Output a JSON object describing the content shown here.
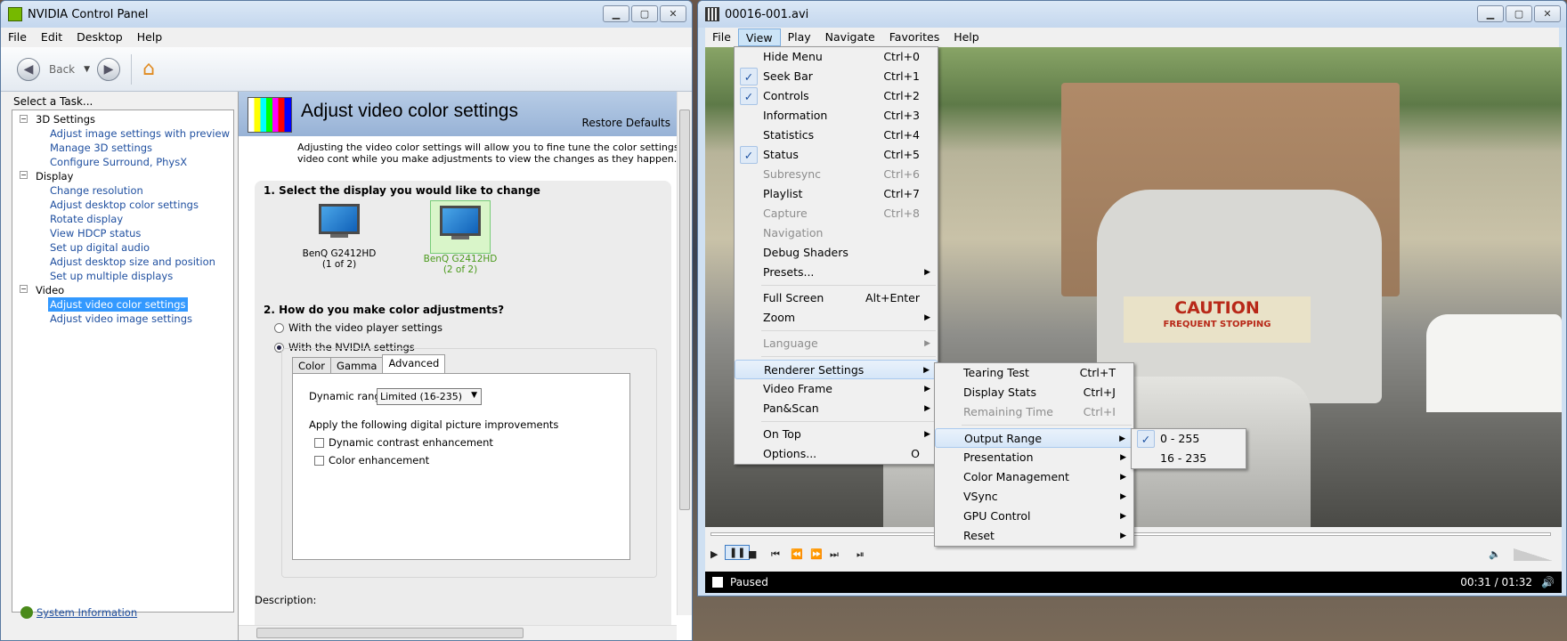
{
  "nvidia": {
    "title": "NVIDIA Control Panel",
    "menus": [
      "File",
      "Edit",
      "Desktop",
      "Help"
    ],
    "toolbar": {
      "back": "Back"
    },
    "task_header": "Select a Task...",
    "tree": [
      {
        "kind": "cat",
        "label": "3D Settings"
      },
      {
        "kind": "lnk",
        "label": "Adjust image settings with preview"
      },
      {
        "kind": "lnk",
        "label": "Manage 3D settings"
      },
      {
        "kind": "lnk",
        "label": "Configure Surround, PhysX"
      },
      {
        "kind": "cat",
        "label": "Display"
      },
      {
        "kind": "lnk",
        "label": "Change resolution"
      },
      {
        "kind": "lnk",
        "label": "Adjust desktop color settings"
      },
      {
        "kind": "lnk",
        "label": "Rotate display"
      },
      {
        "kind": "lnk",
        "label": "View HDCP status"
      },
      {
        "kind": "lnk",
        "label": "Set up digital audio"
      },
      {
        "kind": "lnk",
        "label": "Adjust desktop size and position"
      },
      {
        "kind": "lnk",
        "label": "Set up multiple displays"
      },
      {
        "kind": "cat",
        "label": "Video"
      },
      {
        "kind": "sel",
        "label": "Adjust video color settings"
      },
      {
        "kind": "lnk",
        "label": "Adjust video image settings"
      }
    ],
    "system_info": "System Information",
    "page_title": "Adjust video color settings",
    "restore": "Restore Defaults",
    "intro": "Adjusting the video color settings will allow you to fine tune the color settings for video cont while you make adjustments to view the changes as they happen.",
    "sec1": "1. Select the display you would like to change",
    "displays": [
      {
        "name": "BenQ G2412HD",
        "idx": "(1 of 2)"
      },
      {
        "name": "BenQ G2412HD",
        "idx": "(2 of 2)"
      }
    ],
    "sec2": "2. How do you make color adjustments?",
    "opt1": "With the video player settings",
    "opt2": "With the NVIDIA settings",
    "tabs": [
      "Color",
      "Gamma",
      "Advanced"
    ],
    "dynamic_label": "Dynamic range:",
    "dynamic_value": "Limited (16-235)",
    "improve_label": "Apply the following digital picture improvements",
    "chk1": "Dynamic contrast enhancement",
    "chk2": "Color enhancement",
    "description": "Description:"
  },
  "mpc": {
    "title": "00016-001.avi",
    "menus": [
      "File",
      "View",
      "Play",
      "Navigate",
      "Favorites",
      "Help"
    ],
    "status": "Paused",
    "time": "00:31 / 01:32",
    "sign_main": "CAUTION",
    "sign_sub": "FREQUENT STOPPING"
  },
  "view_menu": [
    {
      "label": "Hide Menu",
      "sc": "Ctrl+0"
    },
    {
      "label": "Seek Bar",
      "sc": "Ctrl+1",
      "checked": true
    },
    {
      "label": "Controls",
      "sc": "Ctrl+2",
      "checked": true
    },
    {
      "label": "Information",
      "sc": "Ctrl+3"
    },
    {
      "label": "Statistics",
      "sc": "Ctrl+4"
    },
    {
      "label": "Status",
      "sc": "Ctrl+5",
      "checked": true
    },
    {
      "label": "Subresync",
      "sc": "Ctrl+6",
      "disabled": true
    },
    {
      "label": "Playlist",
      "sc": "Ctrl+7"
    },
    {
      "label": "Capture",
      "sc": "Ctrl+8",
      "disabled": true
    },
    {
      "label": "Navigation",
      "disabled": true
    },
    {
      "label": "Debug Shaders"
    },
    {
      "label": "Presets...",
      "sub": true
    },
    {
      "sep": true
    },
    {
      "label": "Full Screen",
      "sc": "Alt+Enter"
    },
    {
      "label": "Zoom",
      "sub": true
    },
    {
      "sep": true
    },
    {
      "label": "Language",
      "sub": true,
      "disabled": true
    },
    {
      "sep": true
    },
    {
      "label": "Renderer Settings",
      "sub": true,
      "hl": true
    },
    {
      "label": "Video Frame",
      "sub": true
    },
    {
      "label": "Pan&Scan",
      "sub": true
    },
    {
      "sep": true
    },
    {
      "label": "On Top",
      "sub": true
    },
    {
      "label": "Options...",
      "sc": "O"
    }
  ],
  "renderer_menu": [
    {
      "label": "Tearing Test",
      "sc": "Ctrl+T"
    },
    {
      "label": "Display Stats",
      "sc": "Ctrl+J"
    },
    {
      "label": "Remaining Time",
      "sc": "Ctrl+I",
      "disabled": true
    },
    {
      "sep": true
    },
    {
      "label": "Output Range",
      "sub": true,
      "hl": true
    },
    {
      "label": "Presentation",
      "sub": true
    },
    {
      "label": "Color Management",
      "sub": true
    },
    {
      "label": "VSync",
      "sub": true
    },
    {
      "label": "GPU Control",
      "sub": true
    },
    {
      "label": "Reset",
      "sub": true
    }
  ],
  "range_menu": [
    {
      "label": "0 - 255",
      "checked": true
    },
    {
      "label": "16 - 235"
    }
  ]
}
